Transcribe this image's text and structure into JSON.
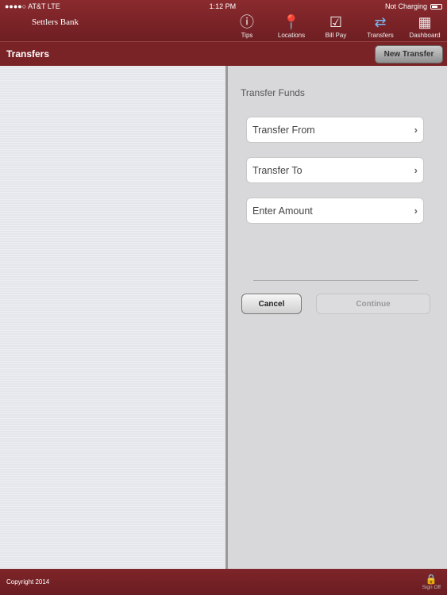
{
  "status": {
    "carrier": "●●●●○ AT&T  LTE",
    "time": "1:12 PM",
    "battery": "Not Charging"
  },
  "brand": "Settlers Bank",
  "nav": [
    {
      "label": "Tips",
      "icon": "ⓘ"
    },
    {
      "label": "Locations",
      "icon": "📍"
    },
    {
      "label": "Bill Pay",
      "icon": "☑"
    },
    {
      "label": "Transfers",
      "icon": "⇄"
    },
    {
      "label": "Dashboard",
      "icon": "▦"
    }
  ],
  "header": {
    "title": "Transfers",
    "new_transfer": "New Transfer"
  },
  "form": {
    "title": "Transfer Funds",
    "rows": [
      "Transfer From",
      "Transfer To",
      "Enter Amount"
    ],
    "cancel": "Cancel",
    "continue": "Continue"
  },
  "footer": {
    "copyright": "Copyright 2014",
    "sign_off": "Sign Off"
  }
}
